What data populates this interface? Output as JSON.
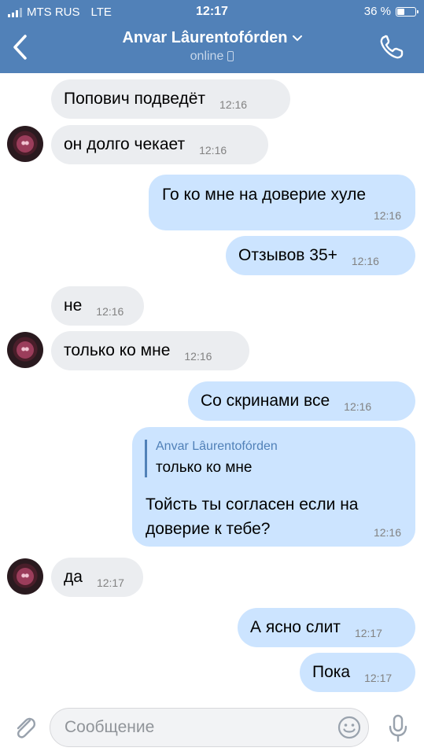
{
  "status_bar": {
    "carrier": "MTS RUS",
    "network": "LTE",
    "time": "12:17",
    "battery": "36 %"
  },
  "header": {
    "title": "Anvar Lâurentofórden",
    "status": "online"
  },
  "messages": [
    {
      "text": "Попович подведёт",
      "time": "12:16",
      "side": "in"
    },
    {
      "text": "он долго чекает",
      "time": "12:16",
      "side": "in"
    },
    {
      "text": "Го ко мне на доверие хуле",
      "time": "12:16",
      "side": "out"
    },
    {
      "text": "Отзывов 35+",
      "time": "12:16",
      "side": "out"
    },
    {
      "text": "не",
      "time": "12:16",
      "side": "in"
    },
    {
      "text": "только ко мне",
      "time": "12:16",
      "side": "in"
    },
    {
      "text": "Со скринами все",
      "time": "12:16",
      "side": "out"
    },
    {
      "reply_name": "Anvar Lâurentofórden",
      "reply_text": "только ко мне",
      "text": "Тойсть ты согласен если на доверие к тебе?",
      "time": "12:16",
      "side": "out"
    },
    {
      "text": "да",
      "time": "12:17",
      "side": "in"
    },
    {
      "text": "А ясно слит",
      "time": "12:17",
      "side": "out"
    },
    {
      "text": "Пока",
      "time": "12:17",
      "side": "out"
    }
  ],
  "composer": {
    "placeholder": "Сообщение"
  },
  "colors": {
    "header": "#5181b8",
    "incoming": "#ebedf0",
    "outgoing": "#cce4ff"
  },
  "icons": [
    "back-icon",
    "chevron-down-icon",
    "phone-icon",
    "call-icon",
    "attach-icon",
    "smile-icon",
    "mic-icon"
  ]
}
